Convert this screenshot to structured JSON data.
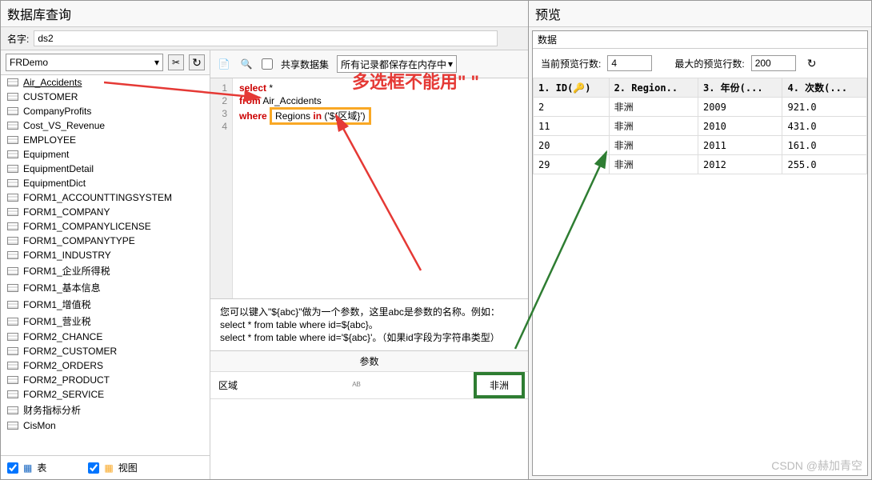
{
  "left": {
    "title": "数据库查询",
    "nameLabel": "名字:",
    "nameValue": "ds2",
    "dbSelect": "FRDemo",
    "tables": [
      "Air_Accidents",
      "CUSTOMER",
      "CompanyProfits",
      "Cost_VS_Revenue",
      "EMPLOYEE",
      "Equipment",
      "EquipmentDetail",
      "EquipmentDict",
      "FORM1_ACCOUNTTINGSYSTEM",
      "FORM1_COMPANY",
      "FORM1_COMPANYLICENSE",
      "FORM1_COMPANYTYPE",
      "FORM1_INDUSTRY",
      "FORM1_企业所得税",
      "FORM1_基本信息",
      "FORM1_增值税",
      "FORM1_营业税",
      "FORM2_CHANCE",
      "FORM2_CUSTOMER",
      "FORM2_ORDERS",
      "FORM2_PRODUCT",
      "FORM2_SERVICE",
      "财务指标分析",
      "CisMon"
    ],
    "filter": {
      "tableLabel": "表",
      "viewLabel": "视图"
    }
  },
  "editor": {
    "toolbar": {
      "shareLabel": "共享数据集",
      "memoryLabel": "所有记录都保存在内存中"
    },
    "sql": {
      "line1a": "select",
      "line1b": " *",
      "line2a": "from",
      "line2b": " Air_Accidents",
      "line3a": "where",
      "line3b": "Regions ",
      "line3c": "in",
      "line3d": " ('${区域}')"
    },
    "hint": {
      "l1": "您可以键入\"${abc}\"做为一个参数，这里abc是参数的名称。例如：",
      "l2": "select * from table where id=${abc}。",
      "l3": "select * from table where id='${abc}'。（如果id字段为字符串类型）"
    },
    "param": {
      "header": "参数",
      "name": "区域",
      "value": "非洲"
    }
  },
  "preview": {
    "title": "预览",
    "dataLabel": "数据",
    "currentRowsLabel": "当前预览行数:",
    "currentRows": "4",
    "maxRowsLabel": "最大的预览行数:",
    "maxRows": "200",
    "cols": [
      "1. ID(🔑)",
      "2. Region..",
      "3. 年份(...",
      "4. 次数(..."
    ],
    "rows": [
      [
        "2",
        "非洲",
        "2009",
        "921.0"
      ],
      [
        "11",
        "非洲",
        "2010",
        "431.0"
      ],
      [
        "20",
        "非洲",
        "2011",
        "161.0"
      ],
      [
        "29",
        "非洲",
        "2012",
        "255.0"
      ]
    ]
  },
  "annotation": "多选框不能用\"    \"",
  "watermark": "CSDN @赫加青空"
}
